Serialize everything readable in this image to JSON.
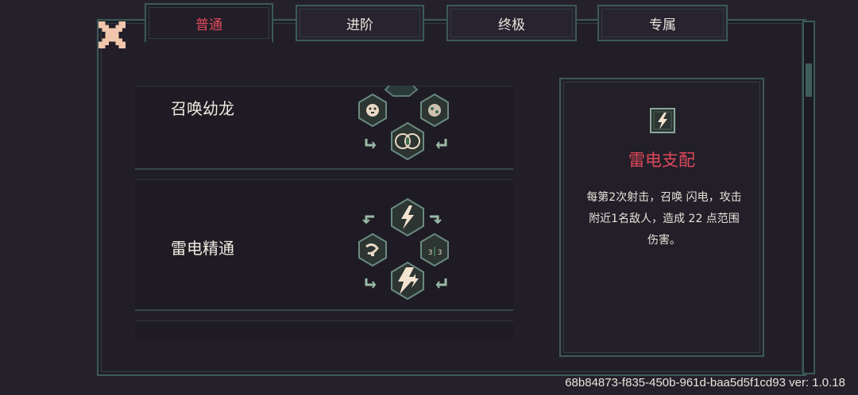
{
  "tabs": [
    {
      "label": "普通",
      "active": true
    },
    {
      "label": "进阶",
      "active": false
    },
    {
      "label": "终极",
      "active": false
    },
    {
      "label": "专属",
      "active": false
    }
  ],
  "skills": [
    {
      "name": "召唤幼龙"
    },
    {
      "name": "雷电精通"
    }
  ],
  "detail": {
    "title": "雷电支配",
    "description": "每第2次射击，召唤 闪电，攻击附近1名敌人，造成 22 点范围伤害。",
    "icon": "lightning-icon"
  },
  "footer": {
    "version_text": "68b84873-f835-450b-961d-baa5d5f1cd93 ver: 1.0.18"
  },
  "colors": {
    "accent": "#e0485a",
    "border": "#3b5a58",
    "background": "#25212b"
  }
}
